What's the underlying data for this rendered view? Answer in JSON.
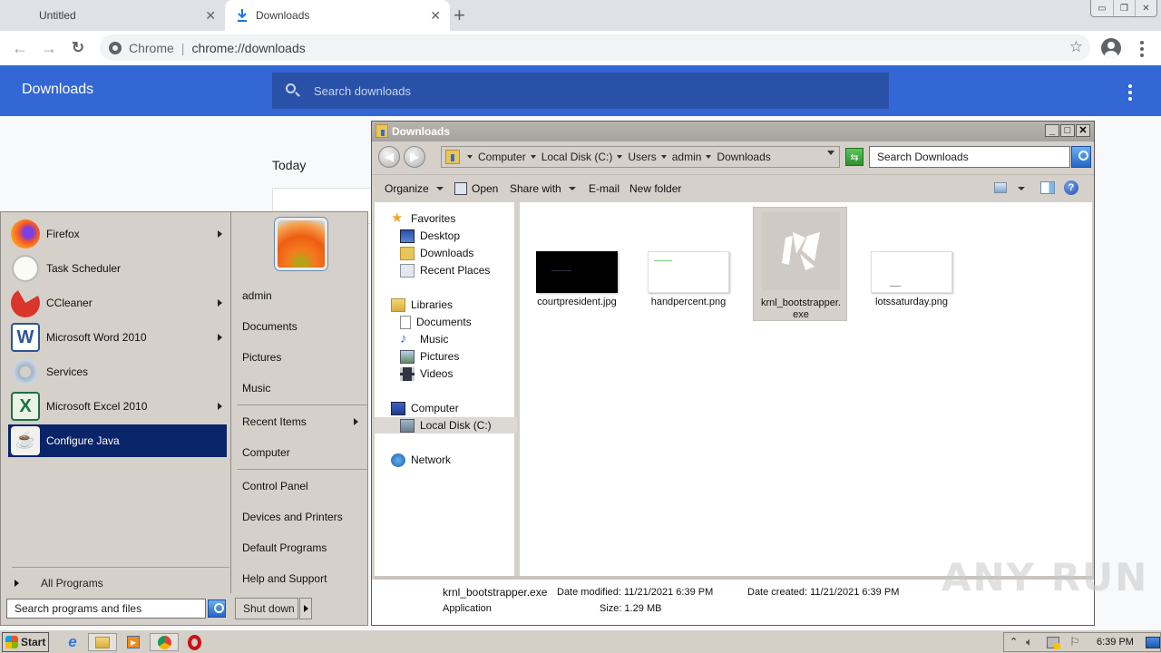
{
  "browser": {
    "tabs": [
      {
        "title": "Untitled",
        "active": false
      },
      {
        "title": "Downloads",
        "active": true,
        "icon": "download-icon"
      }
    ],
    "new_tab_label": "+",
    "omnibox": {
      "scheme_label": "Chrome",
      "url": "chrome://downloads"
    },
    "window_controls": [
      "minimize",
      "restore",
      "close"
    ]
  },
  "downloads_page": {
    "title": "Downloads",
    "search_placeholder": "Search downloads",
    "section_label": "Today",
    "colors": {
      "header": "#3367d6",
      "search": "#2a51a8"
    }
  },
  "start_menu": {
    "programs": [
      {
        "label": "Firefox",
        "icon": "firefox-icon",
        "submenu": true
      },
      {
        "label": "Task Scheduler",
        "icon": "clock-icon",
        "submenu": false
      },
      {
        "label": "CCleaner",
        "icon": "ccleaner-icon",
        "submenu": true
      },
      {
        "label": "Microsoft Word 2010",
        "icon": "word-icon",
        "submenu": true
      },
      {
        "label": "Services",
        "icon": "gears-icon",
        "submenu": false
      },
      {
        "label": "Microsoft Excel 2010",
        "icon": "excel-icon",
        "submenu": true
      },
      {
        "label": "Configure Java",
        "icon": "java-icon",
        "submenu": false,
        "selected": true
      }
    ],
    "all_programs": "All Programs",
    "search_placeholder": "Search programs and files",
    "right_items": [
      {
        "label": "admin"
      },
      {
        "label": "Documents"
      },
      {
        "label": "Pictures"
      },
      {
        "label": "Music"
      },
      {
        "label": "Recent Items",
        "submenu": true
      },
      {
        "label": "Computer"
      },
      {
        "label": "Control Panel"
      },
      {
        "label": "Devices and Printers"
      },
      {
        "label": "Default Programs"
      },
      {
        "label": "Help and Support"
      }
    ],
    "shutdown_label": "Shut down"
  },
  "explorer": {
    "title": "Downloads",
    "breadcrumb": [
      "Computer",
      "Local Disk (C:)",
      "Users",
      "admin",
      "Downloads"
    ],
    "search_placeholder": "Search Downloads",
    "commands": {
      "organize": "Organize",
      "open": "Open",
      "share_with": "Share with",
      "email": "E-mail",
      "new_folder": "New folder"
    },
    "nav": {
      "favorites": {
        "label": "Favorites",
        "items": [
          "Desktop",
          "Downloads",
          "Recent Places"
        ]
      },
      "libraries": {
        "label": "Libraries",
        "items": [
          "Documents",
          "Music",
          "Pictures",
          "Videos"
        ]
      },
      "computer": {
        "label": "Computer",
        "items": [
          "Local Disk (C:)"
        ]
      },
      "network": {
        "label": "Network"
      }
    },
    "files": [
      {
        "name": "courtpresident.jpg",
        "thumb": "dark"
      },
      {
        "name": "handpercent.png",
        "thumb": "white"
      },
      {
        "name": "krnl_bootstrapper.exe",
        "name_line1": "krnl_bootstrapper.",
        "name_line2": "exe",
        "thumb": "exe",
        "selected": true
      },
      {
        "name": "lotssaturday.png",
        "thumb": "white"
      }
    ],
    "details": {
      "name": "krnl_bootstrapper.exe",
      "type": "Application",
      "date_modified": "Date modified: 11/21/2021 6:39 PM",
      "date_created": "Date created: 11/21/2021 6:39 PM",
      "size": "Size: 1.29 MB"
    }
  },
  "taskbar": {
    "start_label": "Start",
    "pinned": [
      "internet-explorer-icon",
      "explorer-icon",
      "media-player-icon",
      "chrome-icon",
      "opera-icon"
    ],
    "clock": "6:39 PM"
  },
  "watermark": "ANY RUN"
}
